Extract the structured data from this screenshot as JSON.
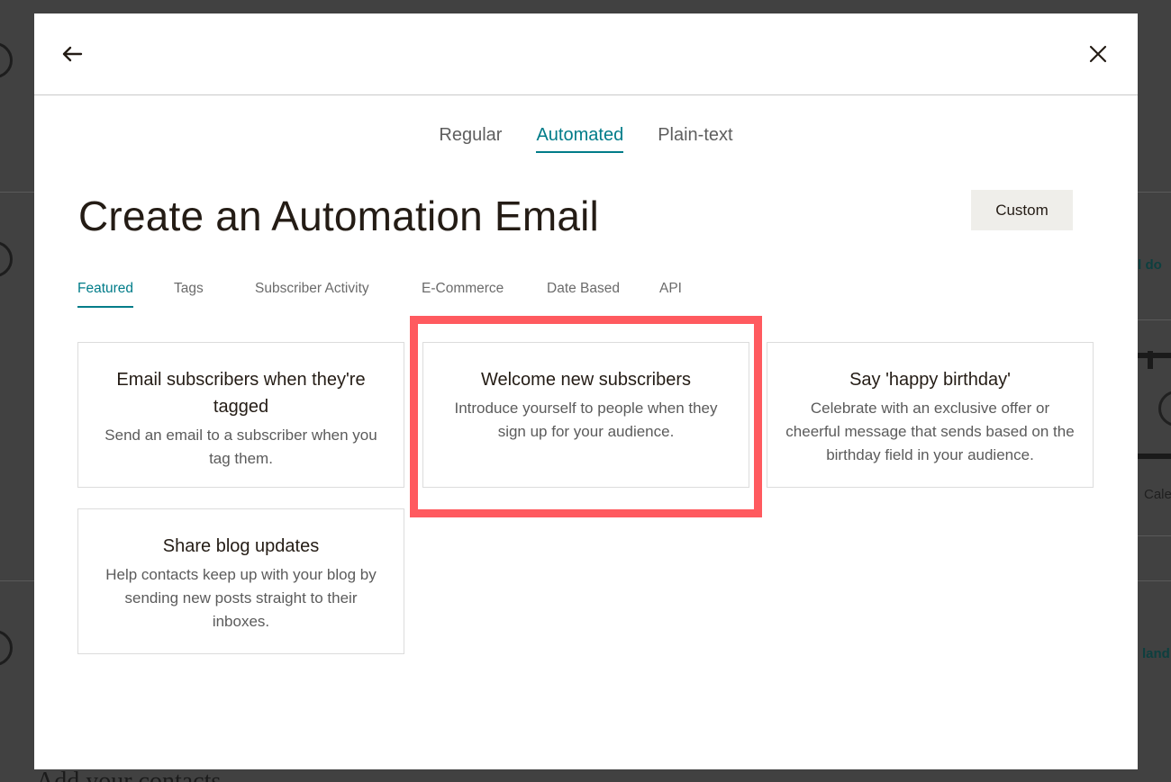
{
  "background": {
    "link_text_1": "ll do",
    "link_text_2": "land",
    "side_text": "Cale",
    "heading_fragment": "Add your contacts"
  },
  "modal": {
    "back_icon": "arrow-left-icon",
    "close_icon": "close-icon",
    "type_tabs": [
      {
        "label": "Regular",
        "active": false
      },
      {
        "label": "Automated",
        "active": true
      },
      {
        "label": "Plain-text",
        "active": false
      }
    ],
    "title": "Create an Automation Email",
    "custom_button_label": "Custom",
    "category_tabs": [
      {
        "label": "Featured",
        "active": true
      },
      {
        "label": "Tags",
        "active": false
      },
      {
        "label": "Subscriber Activity",
        "active": false
      },
      {
        "label": "E-Commerce",
        "active": false
      },
      {
        "label": "Date Based",
        "active": false
      },
      {
        "label": "API",
        "active": false
      }
    ],
    "cards": [
      {
        "title": "Email subscribers when they're tagged",
        "description": "Send an email to a subscriber when you tag them."
      },
      {
        "title": "Welcome new subscribers",
        "description": "Introduce yourself to people when they sign up for your audience."
      },
      {
        "title": "Say 'happy birthday'",
        "description": "Celebrate with an exclusive offer or cheerful message that sends based on the birthday field in your audience."
      },
      {
        "title": "Share blog updates",
        "description": "Help contacts keep up with your blog by sending new posts straight to their inboxes."
      }
    ]
  },
  "colors": {
    "accent": "#007c89",
    "highlight": "#ff5a5f",
    "text": "#241c15",
    "button_bg": "#efeeea"
  }
}
